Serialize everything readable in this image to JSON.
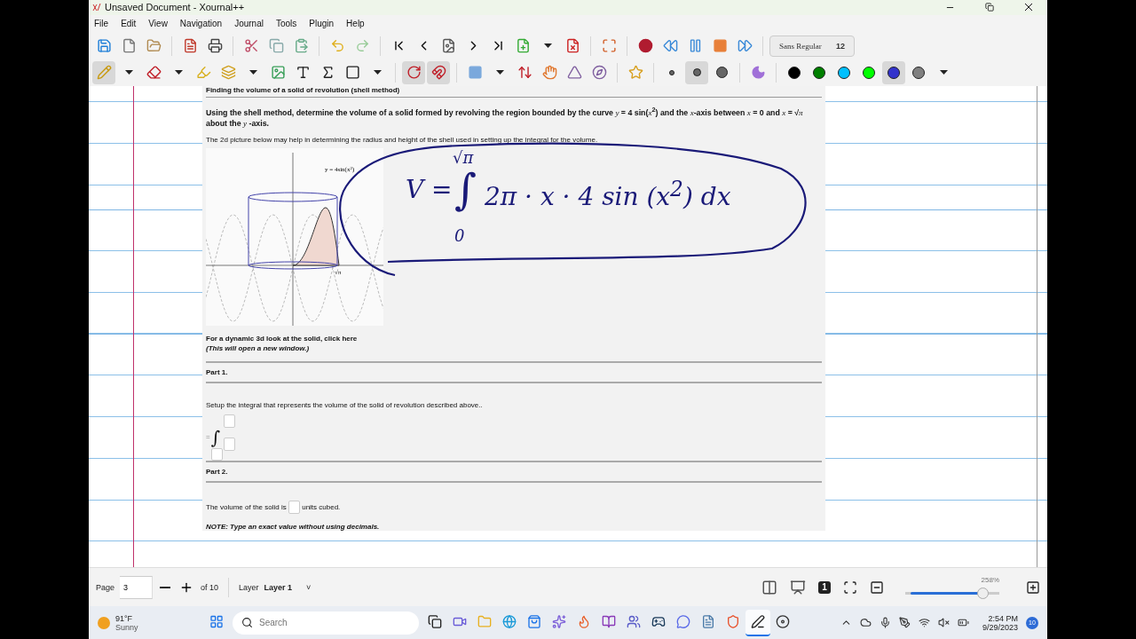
{
  "window": {
    "title": "Unsaved Document - Xournal++"
  },
  "menu": [
    "File",
    "Edit",
    "View",
    "Navigation",
    "Journal",
    "Tools",
    "Plugin",
    "Help"
  ],
  "toolbar_main": [
    {
      "kind": "save"
    },
    {
      "kind": "new"
    },
    {
      "kind": "open"
    },
    {
      "kind": "separator"
    },
    {
      "kind": "pdf"
    },
    {
      "kind": "print"
    },
    {
      "kind": "separator"
    },
    {
      "kind": "cut"
    },
    {
      "kind": "copy"
    },
    {
      "kind": "paste"
    },
    {
      "kind": "separator"
    },
    {
      "kind": "undo"
    },
    {
      "kind": "redo"
    },
    {
      "kind": "separator"
    },
    {
      "kind": "first"
    },
    {
      "kind": "previous"
    },
    {
      "kind": "goto"
    },
    {
      "kind": "next"
    },
    {
      "kind": "last"
    },
    {
      "kind": "add_page"
    },
    {
      "kind": "dropdown"
    },
    {
      "kind": "delete_page"
    },
    {
      "kind": "separator"
    },
    {
      "kind": "fullscreen"
    },
    {
      "kind": "separator"
    },
    {
      "kind": "record"
    },
    {
      "kind": "rewind"
    },
    {
      "kind": "pause"
    },
    {
      "kind": "stop"
    },
    {
      "kind": "forward"
    },
    {
      "kind": "separator"
    }
  ],
  "font_button": {
    "font": "Sans Regular",
    "size": "12"
  },
  "toolbar_tools": [
    {
      "kind": "pen",
      "selected": true
    },
    {
      "kind": "dropdown",
      "selected": false
    },
    {
      "kind": "eraser",
      "selected": false
    },
    {
      "kind": "dropdown",
      "selected": false
    },
    {
      "kind": "highlighter",
      "selected": false
    },
    {
      "kind": "select",
      "selected": false
    },
    {
      "kind": "dropdown",
      "selected": false
    },
    {
      "kind": "image",
      "selected": false
    },
    {
      "kind": "text",
      "selected": false
    },
    {
      "kind": "tex",
      "selected": false
    },
    {
      "kind": "shape",
      "selected": false
    },
    {
      "kind": "dropdown",
      "selected": false
    },
    {
      "kind": "separator"
    },
    {
      "kind": "rotation_snap",
      "selected": true
    },
    {
      "kind": "grid_snap",
      "selected": true
    },
    {
      "kind": "separator"
    },
    {
      "kind": "fill_square",
      "selected": false
    },
    {
      "kind": "dropdown",
      "selected": false
    },
    {
      "kind": "vertical_space",
      "selected": false
    },
    {
      "kind": "hand",
      "selected": false
    },
    {
      "kind": "setsquare",
      "selected": false
    },
    {
      "kind": "compass",
      "selected": false
    },
    {
      "kind": "separator"
    },
    {
      "kind": "favorite",
      "selected": false
    },
    {
      "kind": "separator"
    },
    {
      "kind": "dot_small",
      "selected": false
    },
    {
      "kind": "dot_medium",
      "selected": true
    },
    {
      "kind": "dot_large",
      "selected": false
    },
    {
      "kind": "separator"
    },
    {
      "kind": "fill",
      "selected": false
    },
    {
      "kind": "separator"
    },
    {
      "kind": "color",
      "color": "#000000",
      "selected": false
    },
    {
      "kind": "color",
      "color": "#008000",
      "selected": false
    },
    {
      "kind": "color",
      "color": "#00c0ff",
      "selected": false
    },
    {
      "kind": "color",
      "color": "#00ff00",
      "selected": false
    },
    {
      "kind": "color",
      "color": "#3333cc",
      "selected": true
    },
    {
      "kind": "color",
      "color": "#808080",
      "selected": false
    },
    {
      "kind": "dropdown",
      "selected": false
    }
  ],
  "document": {
    "heading": "Finding the volume of a solid of revolution (shell method)",
    "question": "Using the shell method, determine the volume of a solid formed by revolving the region bounded by the curve *y* = 4 sin(*x*$^{2}$) and the *x*-axis between *x* = 0 and *x* = √*π* about the *y* -axis.",
    "hint": "The 2d picture below may help in determining the radius and height of the shell used in setting up the integral for the volume.",
    "graph": {
      "curve_label": "y = 4sin(x$^{2}$)",
      "tick_label": "√π"
    },
    "link_sentence": "For a dynamic 3d look at the solid, click",
    "link": "here",
    "window_note": "(This will open a new window.)",
    "parts": [
      {
        "kind": "integral",
        "title": "Part 1.",
        "prompt": "Setup the integral that represents the volume of the solid of revolution described above..",
        "lead": "=",
        "symbol": "∫"
      },
      {
        "kind": "answer",
        "title": "Part 2.",
        "before": "The volume of the solid is",
        "after": "units cubed.",
        "note": "NOTE: Type an exact value without using decimals."
      }
    ]
  },
  "ink": {
    "lhs": "V =",
    "integral": "∫",
    "upper": "√π",
    "lower": "0",
    "integrand": "2π · x · 4 sin (x$^{2}$) dx"
  },
  "status_bar": {
    "page_label": "Page",
    "page": "3",
    "of": "of 10",
    "layer_label": "Layer",
    "layer": "Layer 1",
    "layer_caret": "˅",
    "zoom_one": "1",
    "zoom": {
      "reading": "258%",
      "level": 0.82
    }
  },
  "taskbar": {
    "weather": {
      "temp": "91°F",
      "condition": "Sunny"
    },
    "search": {
      "placeholder": "Search"
    },
    "apps": [
      {
        "kind": "start",
        "selected": false
      },
      {
        "kind": "taskview",
        "selected": false
      },
      {
        "kind": "meet",
        "selected": false
      },
      {
        "kind": "folder",
        "selected": false
      },
      {
        "kind": "browser",
        "selected": false
      },
      {
        "kind": "store",
        "selected": false
      },
      {
        "kind": "copilot",
        "selected": false
      },
      {
        "kind": "firefox",
        "selected": false
      },
      {
        "kind": "notes",
        "selected": false
      },
      {
        "kind": "teams",
        "selected": false
      },
      {
        "kind": "steam",
        "selected": false
      },
      {
        "kind": "chat",
        "selected": false
      },
      {
        "kind": "document",
        "selected": false
      },
      {
        "kind": "shield",
        "selected": false
      },
      {
        "kind": "xournal",
        "selected": true
      },
      {
        "kind": "recorder",
        "selected": false
      }
    ],
    "time": "2:54 PM",
    "date": "9/29/2023",
    "notifications": "10"
  }
}
